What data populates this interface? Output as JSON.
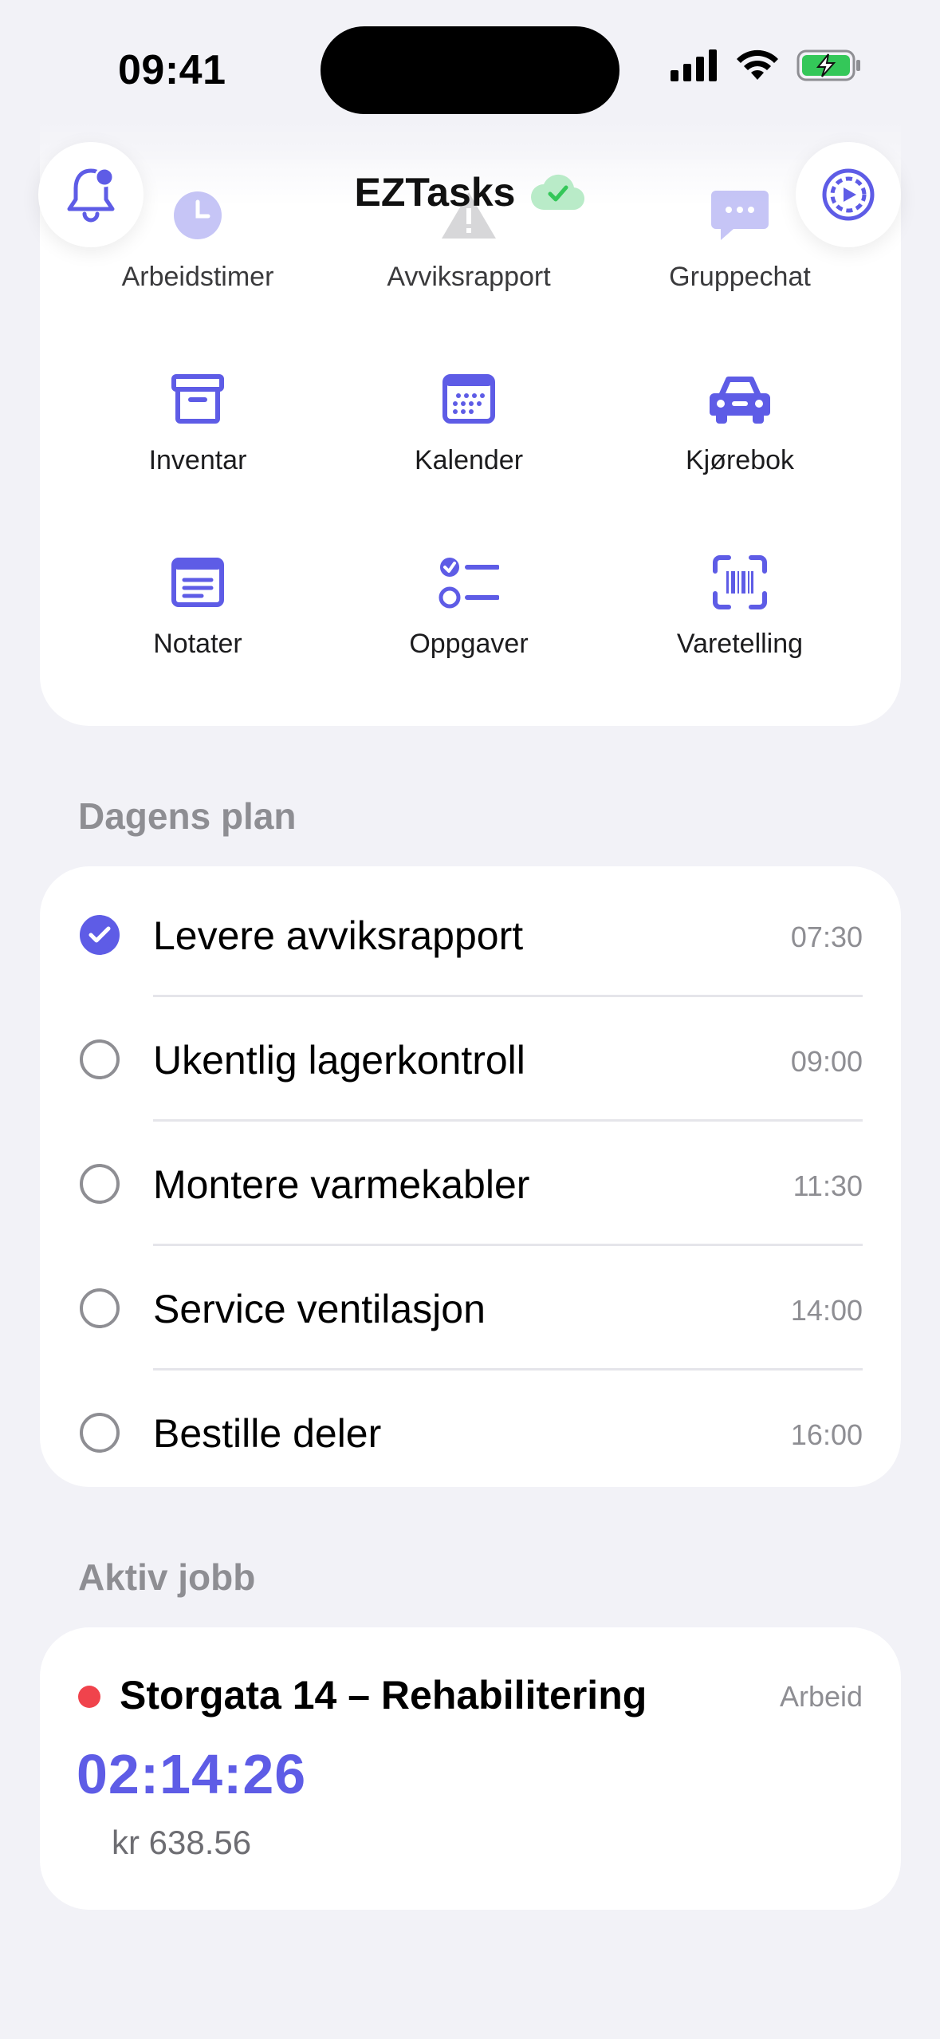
{
  "status_bar": {
    "time": "09:41"
  },
  "header": {
    "app_title": "EZTasks"
  },
  "apps": [
    {
      "label": "Arbeidstimer",
      "icon": "clock-icon"
    },
    {
      "label": "Avviksrapport",
      "icon": "warning-icon"
    },
    {
      "label": "Gruppechat",
      "icon": "chat-icon"
    },
    {
      "label": "Inventar",
      "icon": "archive-box-icon"
    },
    {
      "label": "Kalender",
      "icon": "calendar-icon"
    },
    {
      "label": "Kjørebok",
      "icon": "car-icon"
    },
    {
      "label": "Notater",
      "icon": "notes-icon"
    },
    {
      "label": "Oppgaver",
      "icon": "checklist-icon"
    },
    {
      "label": "Varetelling",
      "icon": "barcode-scan-icon"
    }
  ],
  "plan": {
    "section_title": "Dagens plan",
    "tasks": [
      {
        "title": "Levere avviksrapport",
        "time": "07:30",
        "done": true
      },
      {
        "title": "Ukentlig lagerkontroll",
        "time": "09:00",
        "done": false
      },
      {
        "title": "Montere varmekabler",
        "time": "11:30",
        "done": false
      },
      {
        "title": "Service ventilasjon",
        "time": "14:00",
        "done": false
      },
      {
        "title": "Bestille deler",
        "time": "16:00",
        "done": false
      }
    ]
  },
  "active_job": {
    "section_title": "Aktiv jobb",
    "title": "Storgata 14 – Rehabilitering",
    "tag": "Arbeid",
    "timer": "02:14:26",
    "amount": "kr 638.56",
    "status_color": "#F0434C"
  },
  "colors": {
    "accent": "#5E5CE6",
    "background": "#F2F2F7",
    "secondary_text": "#8E8E93",
    "sync_ok": "#34C759"
  }
}
